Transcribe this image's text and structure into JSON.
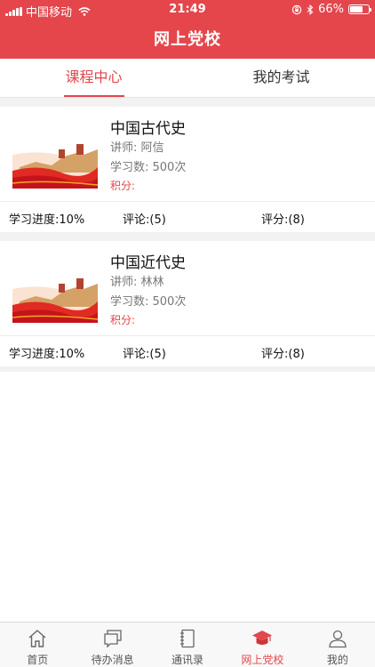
{
  "status_bar": {
    "carrier": "中国移动",
    "time": "21:49",
    "battery": "66%",
    "battery_level": 0.66
  },
  "header": {
    "title": "网上党校"
  },
  "tabs": [
    {
      "label": "课程中心",
      "active": true
    },
    {
      "label": "我的考试",
      "active": false
    }
  ],
  "courses": [
    {
      "title": "中国古代史",
      "teacher": "讲师:  阿信",
      "study_count": "学习数:  500次",
      "points": "积分:",
      "progress": "学习进度:10%",
      "comments": "评论:(5)",
      "rating": "评分:(8)"
    },
    {
      "title": "中国近代史",
      "teacher": "讲师:  林林",
      "study_count": "学习数:  500次",
      "points": "积分:",
      "progress": "学习进度:10%",
      "comments": "评论:(5)",
      "rating": "评分:(8)"
    }
  ],
  "tabbar": [
    {
      "label": "首页",
      "icon": "home-icon",
      "active": false
    },
    {
      "label": "待办消息",
      "icon": "message-icon",
      "active": false
    },
    {
      "label": "通讯录",
      "icon": "address-book-icon",
      "active": false
    },
    {
      "label": "网上党校",
      "icon": "graduation-cap-icon",
      "active": true
    },
    {
      "label": "我的",
      "icon": "user-icon",
      "active": false
    }
  ],
  "colors": {
    "accent": "#e4464c",
    "background": "#f2f2f2",
    "tabbar": "#f8f8f8"
  }
}
